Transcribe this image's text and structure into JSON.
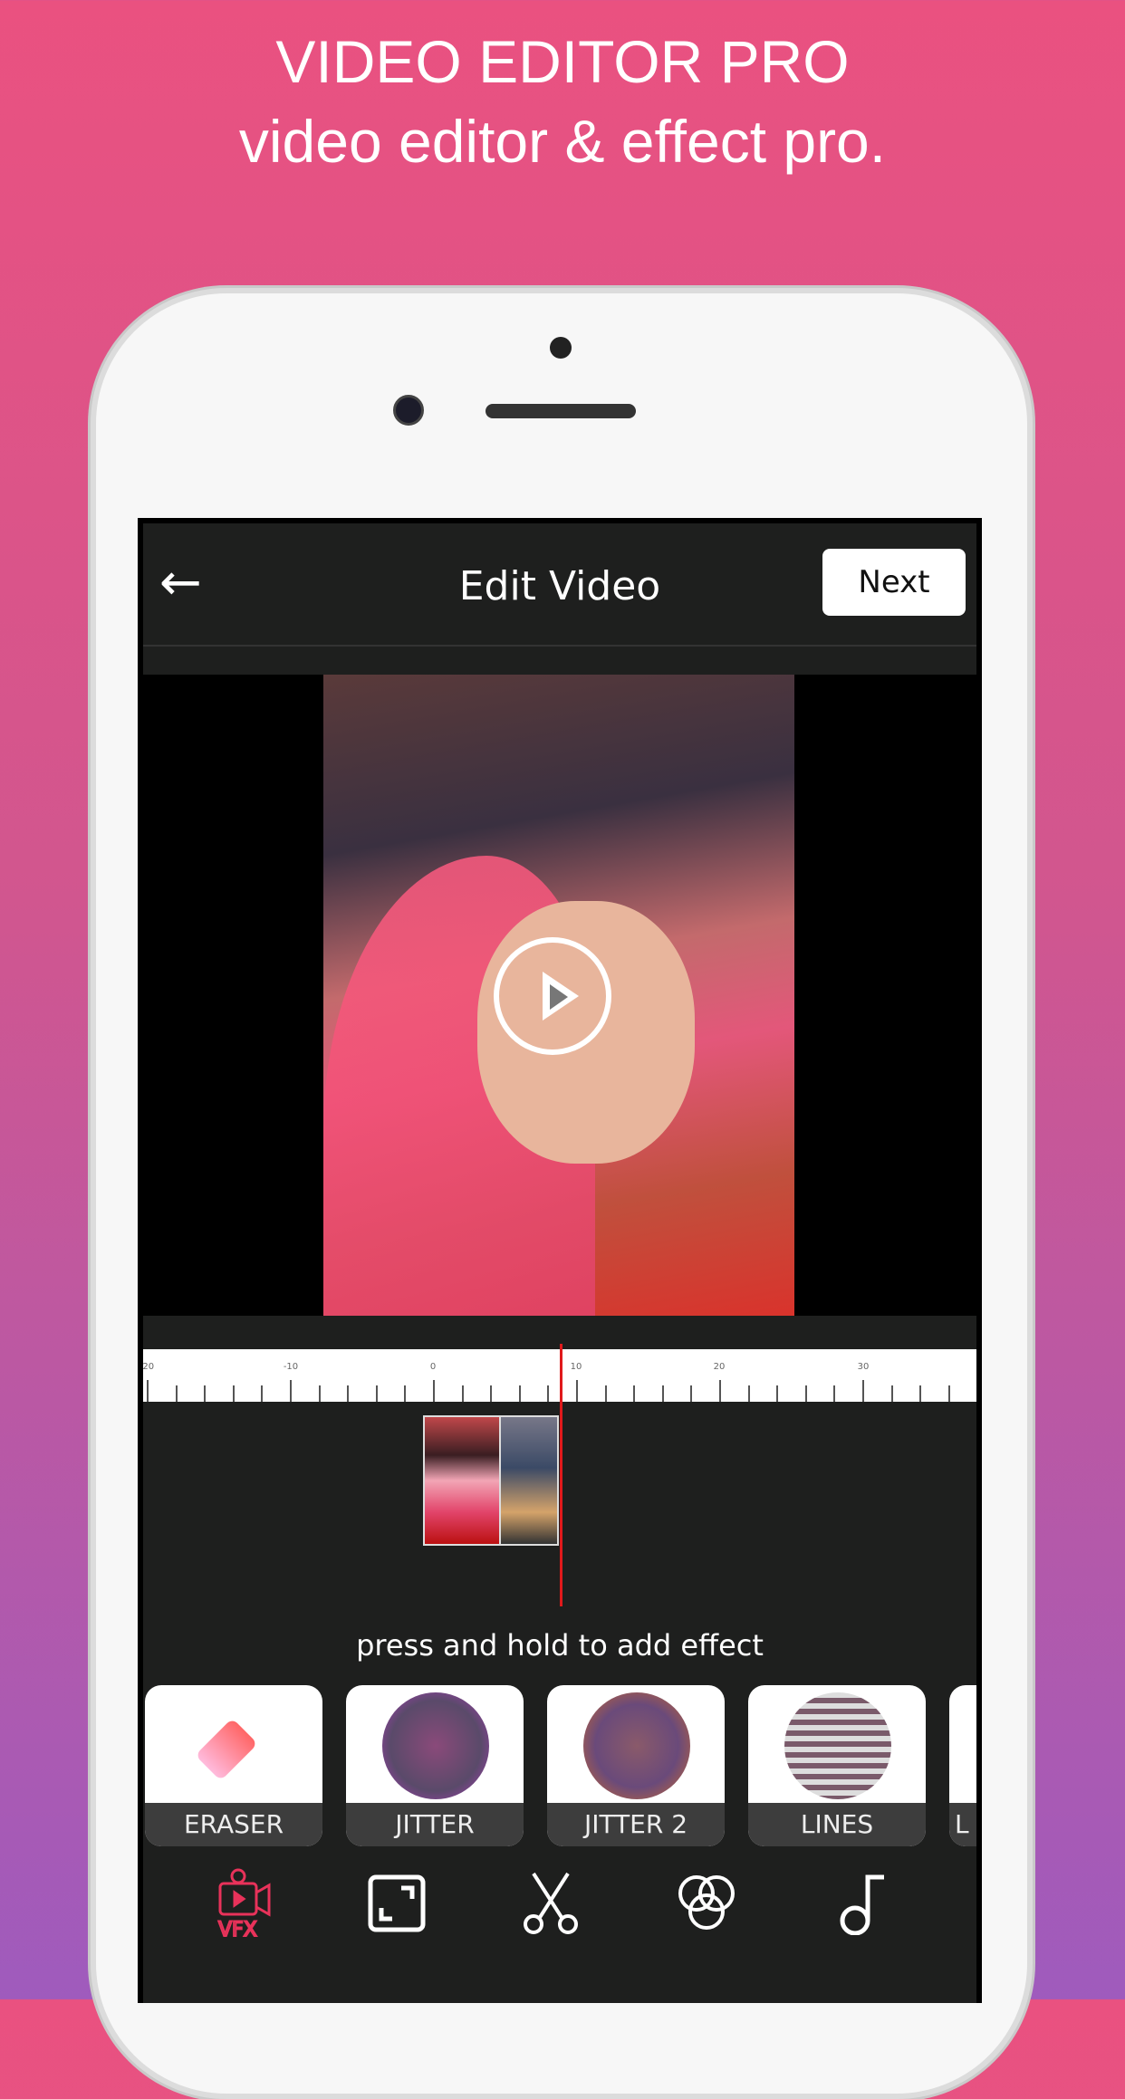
{
  "promo": {
    "title": "VIDEO EDITOR PRO",
    "subtitle": "video editor & effect pro."
  },
  "header": {
    "back_icon": "arrow-left-icon",
    "title": "Edit Video",
    "next_label": "Next"
  },
  "timeline": {
    "ruler_labels": [
      "-20",
      "-10",
      "0",
      "10",
      "20",
      "30"
    ],
    "playhead_color": "#e0191b"
  },
  "hint": "press and hold to add effect",
  "effects": [
    {
      "label": "ERASER"
    },
    {
      "label": "JITTER"
    },
    {
      "label": "JITTER 2"
    },
    {
      "label": "LINES"
    },
    {
      "label": "L"
    }
  ],
  "tools": [
    {
      "icon": "vfx-camera-icon",
      "active": true
    },
    {
      "icon": "resize-icon"
    },
    {
      "icon": "scissors-icon"
    },
    {
      "icon": "color-circles-icon"
    },
    {
      "icon": "music-note-icon"
    }
  ],
  "colors": {
    "accent": "#e8325a",
    "bg": "#1e1f1e"
  }
}
